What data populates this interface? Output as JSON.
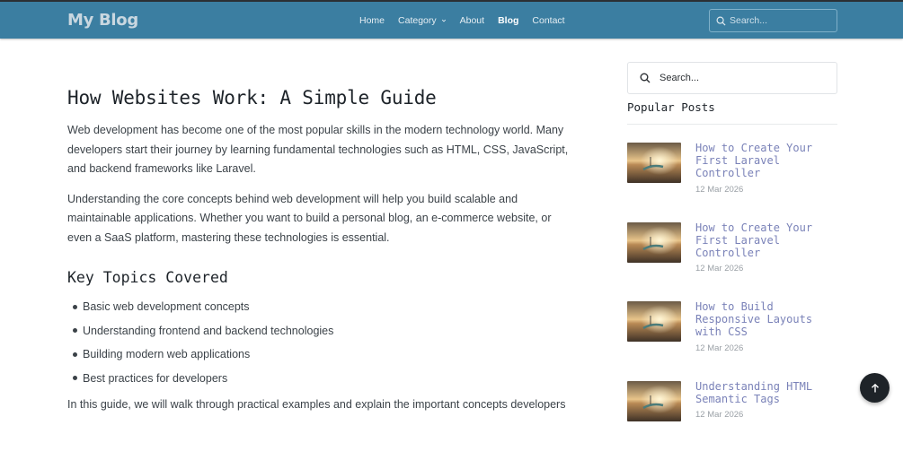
{
  "navbar": {
    "brand": "My Blog",
    "links": [
      {
        "label": "Home"
      },
      {
        "label": "Category"
      },
      {
        "label": "About"
      },
      {
        "label": "Blog"
      },
      {
        "label": "Contact"
      }
    ],
    "active_link": "Blog",
    "search_placeholder": "Search...",
    "bg_color": "#3b7ea1"
  },
  "article": {
    "title": "How Websites Work: A Simple Guide",
    "paragraphs": [
      "Web development has become one of the most popular skills in the modern technology world. Many developers start their journey by learning fundamental technologies such as HTML, CSS, JavaScript, and backend frameworks like Laravel.",
      "Understanding the core concepts behind web development will help you build scalable and maintainable applications. Whether you want to build a personal blog, an e-commerce website, or even a SaaS platform, mastering these technologies is essential."
    ],
    "section_heading": "Key Topics Covered",
    "topics": [
      "Basic web development concepts",
      "Understanding frontend and backend technologies",
      "Building modern web applications",
      "Best practices for developers"
    ],
    "trailing_paragraph": "In this guide, we will walk through practical examples and explain the important concepts developers"
  },
  "sidebar": {
    "search_placeholder": "Search...",
    "popular_title": "Popular Posts",
    "posts": [
      {
        "title": "How to Create Your First Laravel Controller",
        "date": "12 Mar 2026"
      },
      {
        "title": "How to Create Your First Laravel Controller",
        "date": "12 Mar 2026"
      },
      {
        "title": "How to Build Responsive Layouts with CSS",
        "date": "12 Mar 2026"
      },
      {
        "title": "Understanding HTML Semantic Tags",
        "date": "12 Mar 2026"
      }
    ],
    "post_title_color": "#7a82b8"
  },
  "icons": {
    "nav_search": "search-icon",
    "sidebar_search": "search-icon",
    "category_dropdown": "chevron-down-icon",
    "back_to_top": "arrow-up-icon"
  }
}
